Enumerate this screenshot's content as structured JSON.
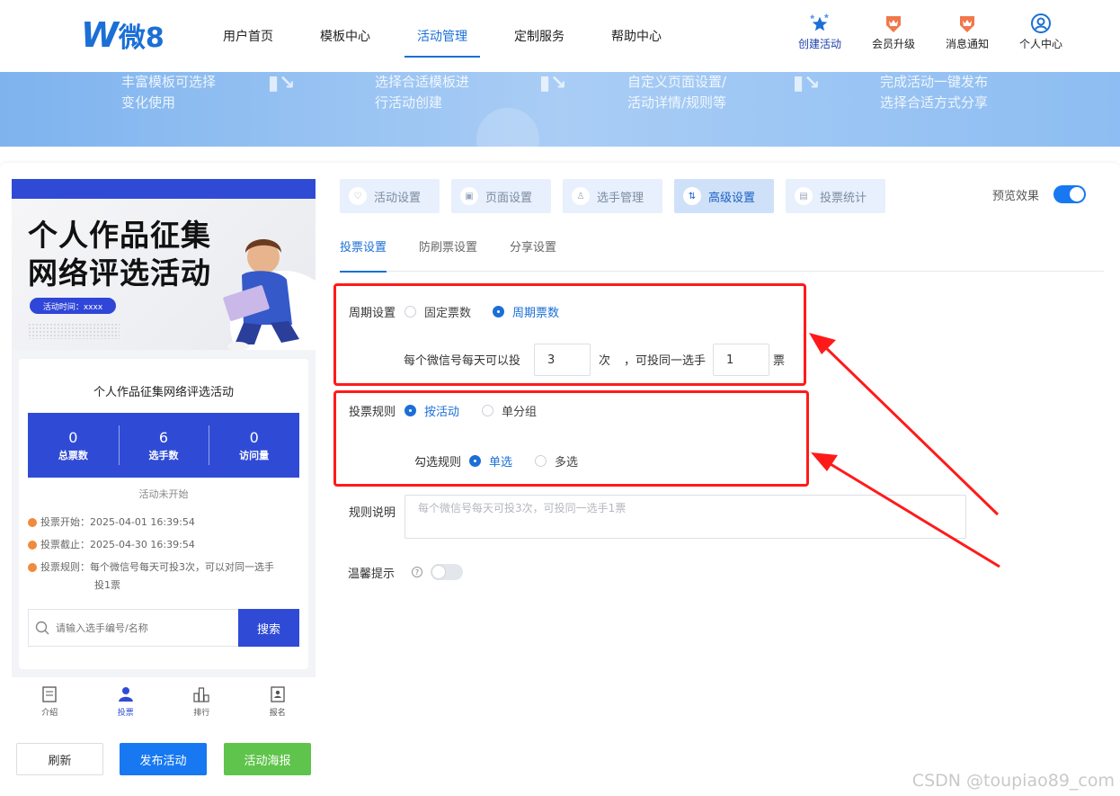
{
  "brand": {
    "logo_text": "微8"
  },
  "nav": [
    "用户首页",
    "模板中心",
    "活动管理",
    "定制服务",
    "帮助中心"
  ],
  "header_actions": [
    "创建活动",
    "会员升级",
    "消息通知",
    "个人中心"
  ],
  "banner_steps": [
    [
      "丰富模板可选择",
      "变化使用"
    ],
    [
      "选择合适模板进",
      "行活动创建"
    ],
    [
      "自定义页面设置/",
      "活动详情/规则等"
    ],
    [
      "完成活动一键发布",
      "选择合适方式分享"
    ]
  ],
  "preview": {
    "poster_line1": "个人作品征集",
    "poster_line2": "网络评选活动",
    "poster_time": "活动时间：xxxx",
    "title": "个人作品征集网络评选活动",
    "stats": [
      {
        "value": "0",
        "label": "总票数"
      },
      {
        "value": "6",
        "label": "选手数"
      },
      {
        "value": "0",
        "label": "访问量"
      }
    ],
    "status": "活动未开始",
    "info_start": "投票开始：2025-04-01 16:39:54",
    "info_end": "投票截止：2025-04-30 16:39:54",
    "info_rule_1": "投票规则：每个微信号每天可投3次，可以对同一选手",
    "info_rule_2": "投1票",
    "search_placeholder": "请输入选手编号/名称",
    "search_button": "搜索",
    "tabbar": [
      "介绍",
      "投票",
      "排行",
      "报名"
    ]
  },
  "actions": {
    "refresh": "刷新",
    "publish": "发布活动",
    "poster": "活动海报"
  },
  "settings_tabs": [
    "活动设置",
    "页面设置",
    "选手管理",
    "高级设置",
    "投票统计"
  ],
  "preview_toggle": {
    "label": "预览效果",
    "on": true
  },
  "sub_tabs": [
    "投票设置",
    "防刷票设置",
    "分享设置"
  ],
  "form": {
    "period_label": "周期设置",
    "period_options": [
      "固定票数",
      "周期票数"
    ],
    "daily_label": "每个微信号每天可以投",
    "daily_value": "3",
    "times_unit": "次",
    "same_label": "，可投同一选手",
    "same_value": "1",
    "vote_unit": "票",
    "rule_label": "投票规则",
    "rule_options": [
      "按活动",
      "单分组"
    ],
    "check_label": "勾选规则",
    "check_options": [
      "单选",
      "多选"
    ],
    "desc_label": "规则说明",
    "desc_value": "每个微信号每天可投3次，可投同一选手1票",
    "tip_label": "温馨提示",
    "tip_on": false
  },
  "watermark": "CSDN @toupiao89_com",
  "colors": {
    "primary": "#1b6fd6",
    "preview_blue": "#2f4bd6",
    "annotation_red": "#ff1a1a",
    "green": "#5fc44b"
  }
}
